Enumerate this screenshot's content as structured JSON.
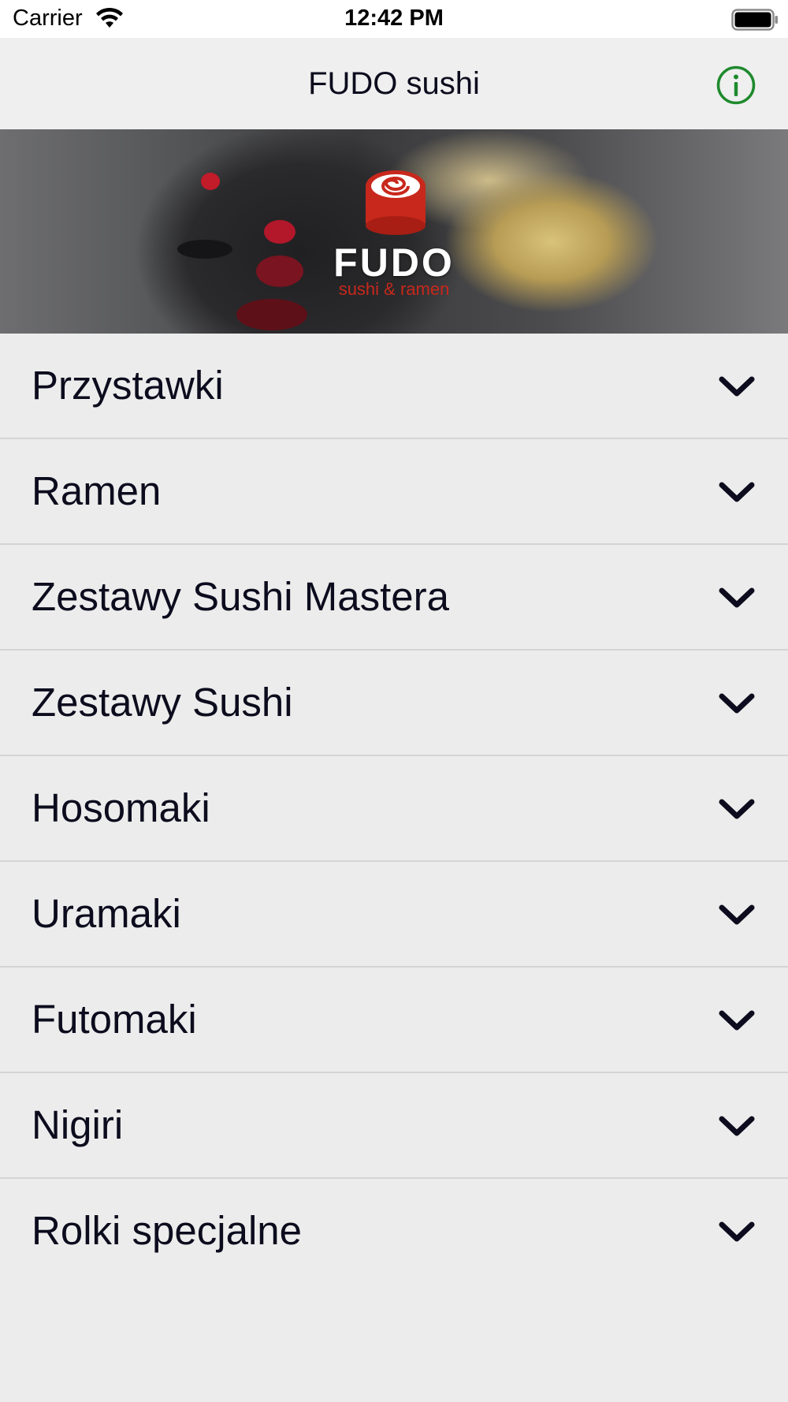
{
  "status_bar": {
    "carrier": "Carrier",
    "time": "12:42 PM"
  },
  "nav": {
    "title": "FUDO sushi",
    "info_icon": "info-circle-icon"
  },
  "hero": {
    "brand": "FUDO",
    "tagline": "sushi & ramen"
  },
  "menu": {
    "items": [
      {
        "label": "Przystawki"
      },
      {
        "label": "Ramen"
      },
      {
        "label": "Zestawy Sushi Mastera"
      },
      {
        "label": "Zestawy Sushi"
      },
      {
        "label": "Hosomaki"
      },
      {
        "label": "Uramaki"
      },
      {
        "label": "Futomaki"
      },
      {
        "label": "Nigiri"
      },
      {
        "label": "Rolki specjalne"
      }
    ]
  },
  "colors": {
    "accent": "#1e8a2e",
    "logo_red": "#c8281c",
    "text": "#0c0c1e",
    "background": "#ececec"
  }
}
